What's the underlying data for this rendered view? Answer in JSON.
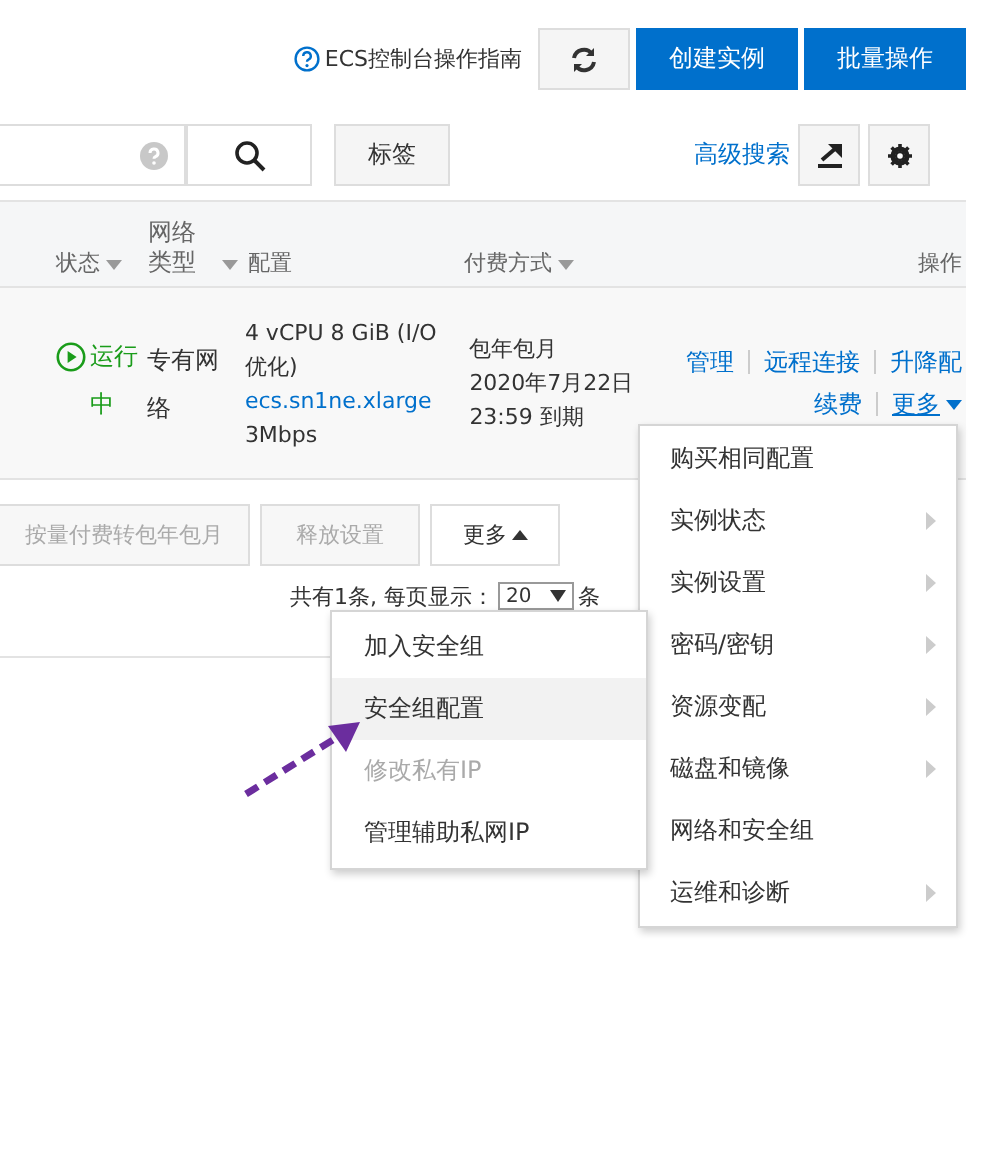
{
  "toolbar": {
    "help_link": "ECS控制台操作指南",
    "buttons": [
      "创建实例",
      "批量操作"
    ]
  },
  "search_bar": {
    "tag_button": "标签",
    "advanced_search": "高级搜索"
  },
  "table": {
    "columns": [
      {
        "label": "状态",
        "sortable": true
      },
      {
        "label": "网络类型",
        "sortable": true
      },
      {
        "label": "配置",
        "sortable": false
      },
      {
        "label": "付费方式",
        "sortable": true
      },
      {
        "label": "操作",
        "sortable": false
      }
    ],
    "rows": [
      {
        "status": "运行中",
        "network": "专有网络",
        "config": {
          "spec": "4 vCPU 8 GiB (I/O优化)",
          "type": "ecs.sn1ne.xlarge",
          "bandwidth": "3Mbps"
        },
        "billing": {
          "type": "包年包月",
          "expiry": "2020年7月22日 23:59 到期"
        },
        "operations": [
          [
            {
              "label": "管理",
              "kind": "link"
            },
            {
              "label": "远程连接",
              "kind": "link"
            },
            {
              "label": "升降配",
              "kind": "link"
            }
          ],
          [
            {
              "label": "续费",
              "kind": "link"
            },
            {
              "label": "更多",
              "kind": "dropdown"
            }
          ]
        ]
      }
    ]
  },
  "bulk_actions": [
    {
      "label": "按量付费转包年包月",
      "disabled": true
    },
    {
      "label": "释放设置",
      "disabled": true
    },
    {
      "label": "更多",
      "disabled": false
    }
  ],
  "pagination": {
    "total_text": "共有1条, 每页显示：",
    "page_size": "20",
    "unit": "条"
  },
  "context_menu": [
    {
      "label": "购买相同配置",
      "has_submenu": false
    },
    {
      "label": "实例状态",
      "has_submenu": true
    },
    {
      "label": "实例设置",
      "has_submenu": true
    },
    {
      "label": "密码/密钥",
      "has_submenu": true
    },
    {
      "label": "资源变配",
      "has_submenu": true
    },
    {
      "label": "磁盘和镜像",
      "has_submenu": true
    },
    {
      "label": "网络和安全组",
      "has_submenu": false
    },
    {
      "label": "运维和诊断",
      "has_submenu": true
    }
  ],
  "submenu": [
    {
      "label": "加入安全组",
      "selected": false,
      "disabled": false
    },
    {
      "label": "安全组配置",
      "selected": true,
      "disabled": false
    },
    {
      "label": "修改私有IP",
      "selected": false,
      "disabled": true
    },
    {
      "label": "管理辅助私网IP",
      "selected": false,
      "disabled": false
    }
  ]
}
